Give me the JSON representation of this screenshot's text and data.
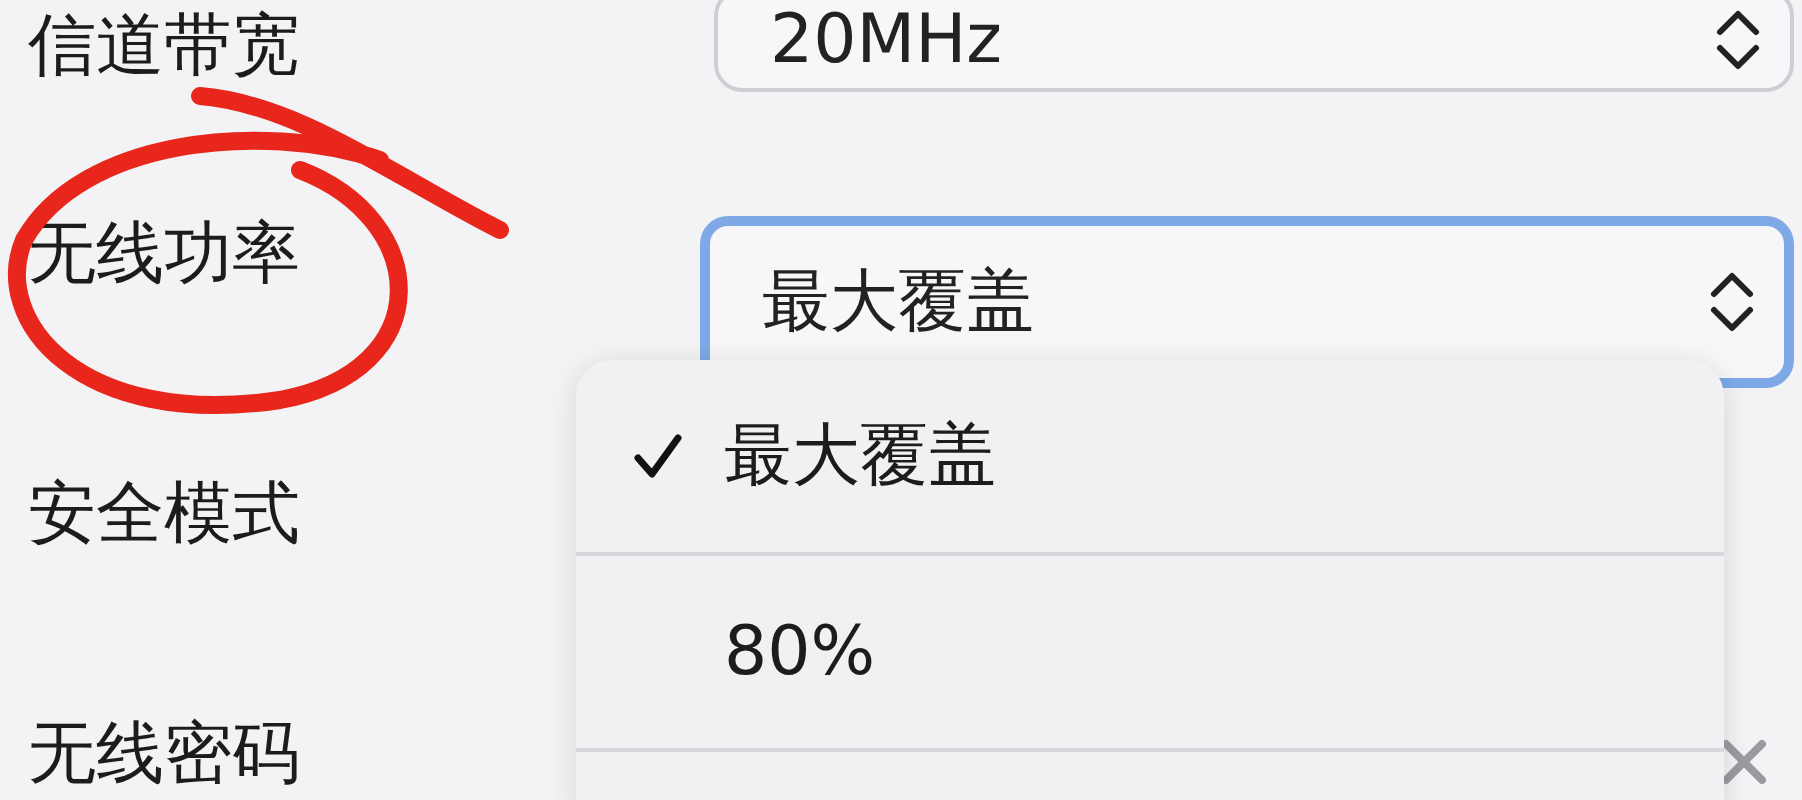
{
  "fields": [
    {
      "label": "信道带宽",
      "value": "20MHz",
      "focused": false
    },
    {
      "label": "无线功率",
      "value": "最大覆盖",
      "focused": true
    },
    {
      "label": "安全模式"
    },
    {
      "label": "无线密码",
      "clearable": true
    }
  ],
  "dropdown": {
    "options": [
      {
        "label": "最大覆盖",
        "selected": true
      },
      {
        "label": "80%",
        "selected": false
      }
    ]
  },
  "annotation": {
    "kind": "circle"
  }
}
